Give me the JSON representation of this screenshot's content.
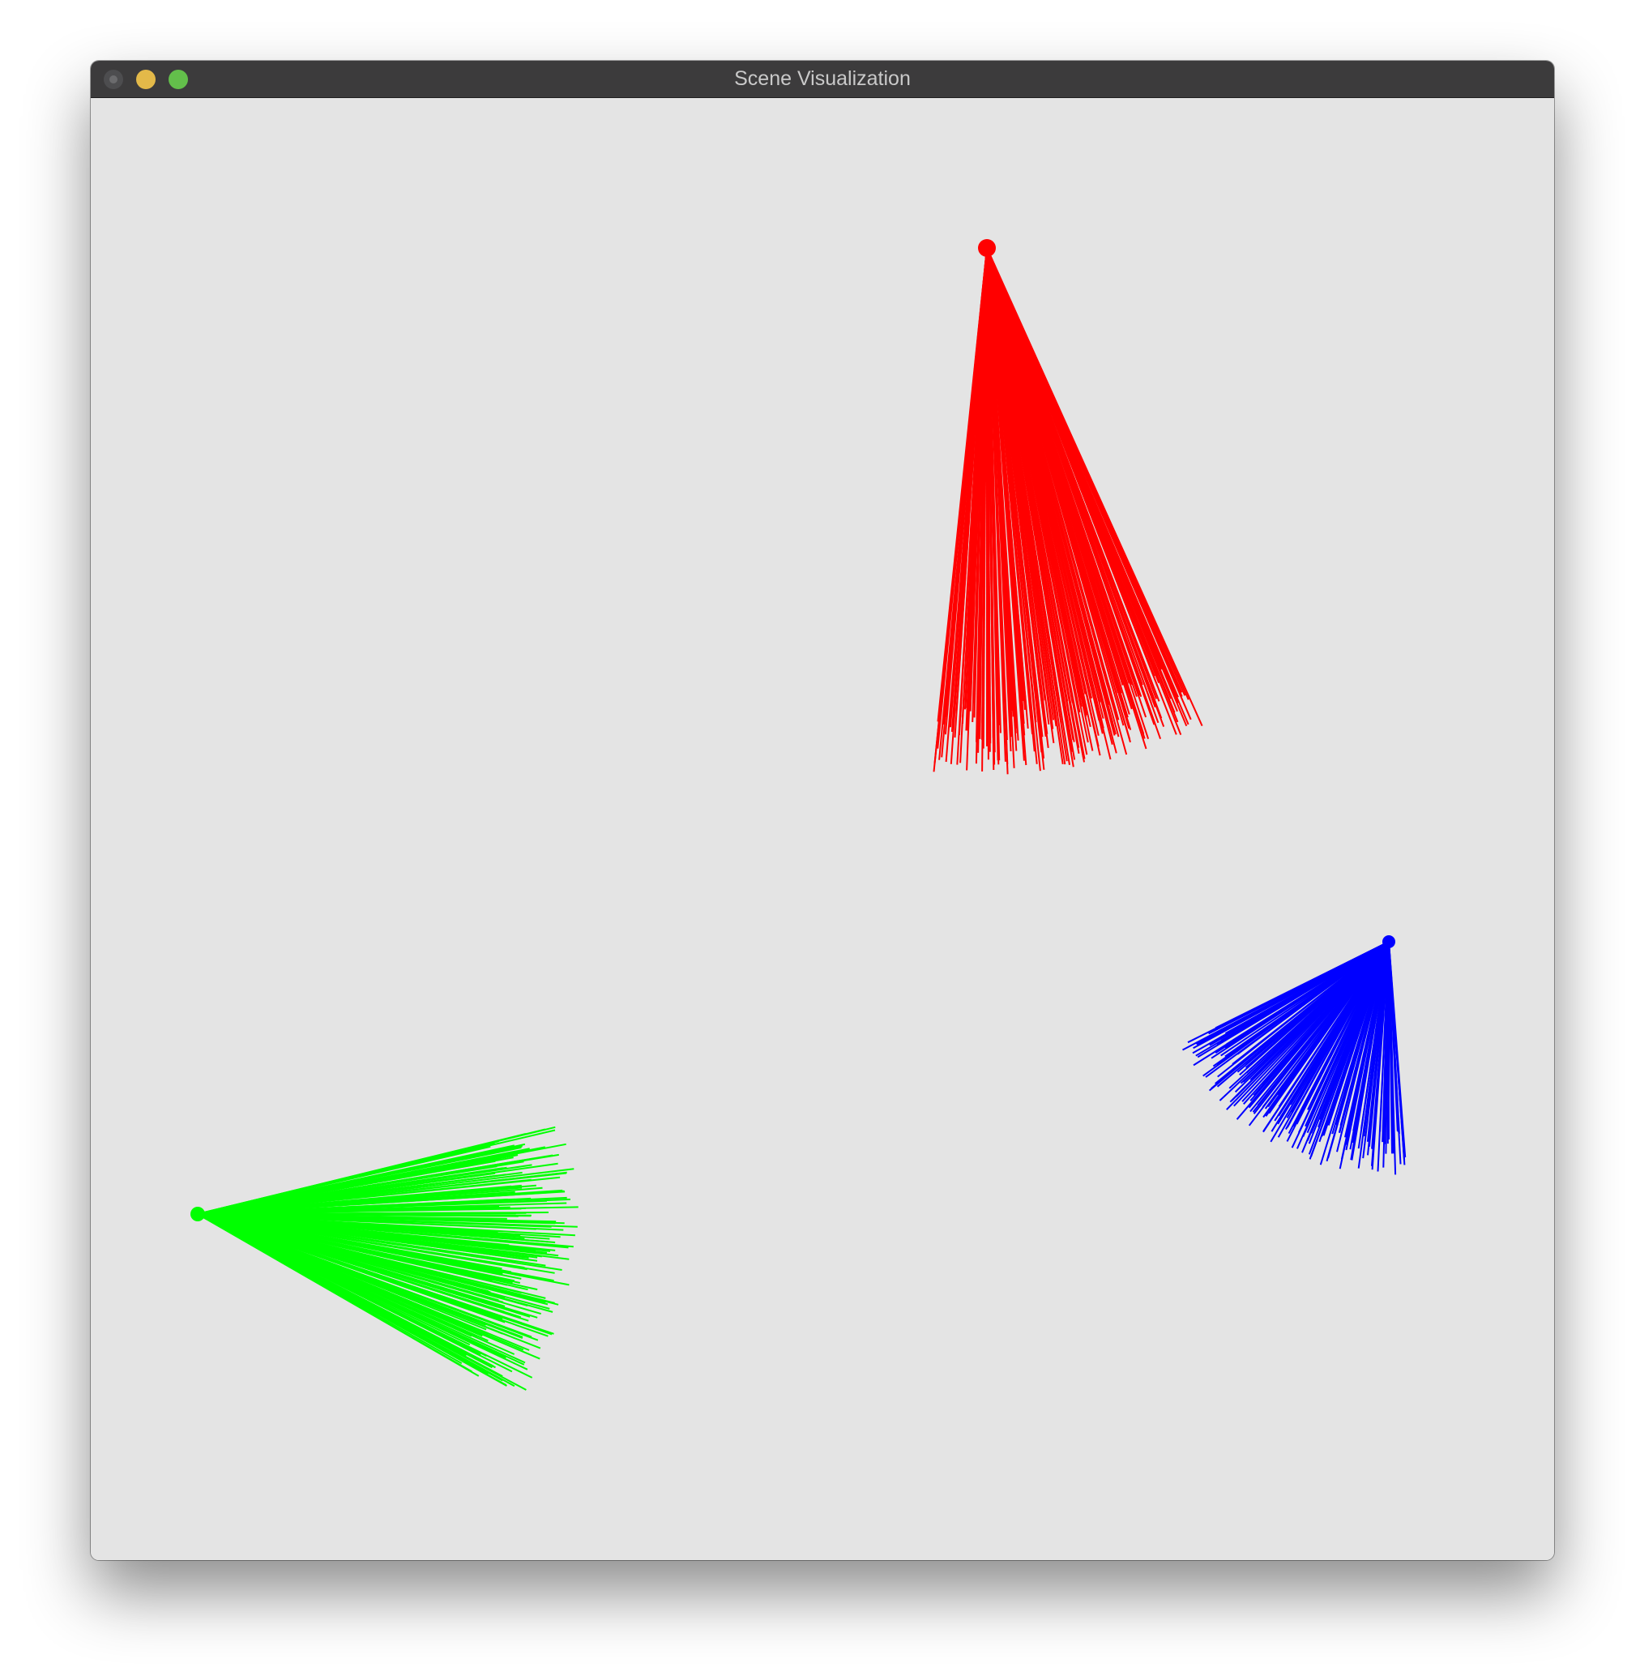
{
  "window": {
    "title": "Scene Visualization"
  },
  "titlebar": {
    "buttons": [
      {
        "name": "close",
        "color": "#4d4d4f"
      },
      {
        "name": "minimize",
        "color": "#e3b949"
      },
      {
        "name": "maximize",
        "color": "#63bf4b"
      }
    ]
  },
  "scene": {
    "background": "#e4e4e4",
    "fans": [
      {
        "name": "red",
        "color": "#ff0000"
      },
      {
        "name": "green",
        "color": "#00ff00"
      },
      {
        "name": "blue",
        "color": "#0000ff"
      }
    ]
  }
}
